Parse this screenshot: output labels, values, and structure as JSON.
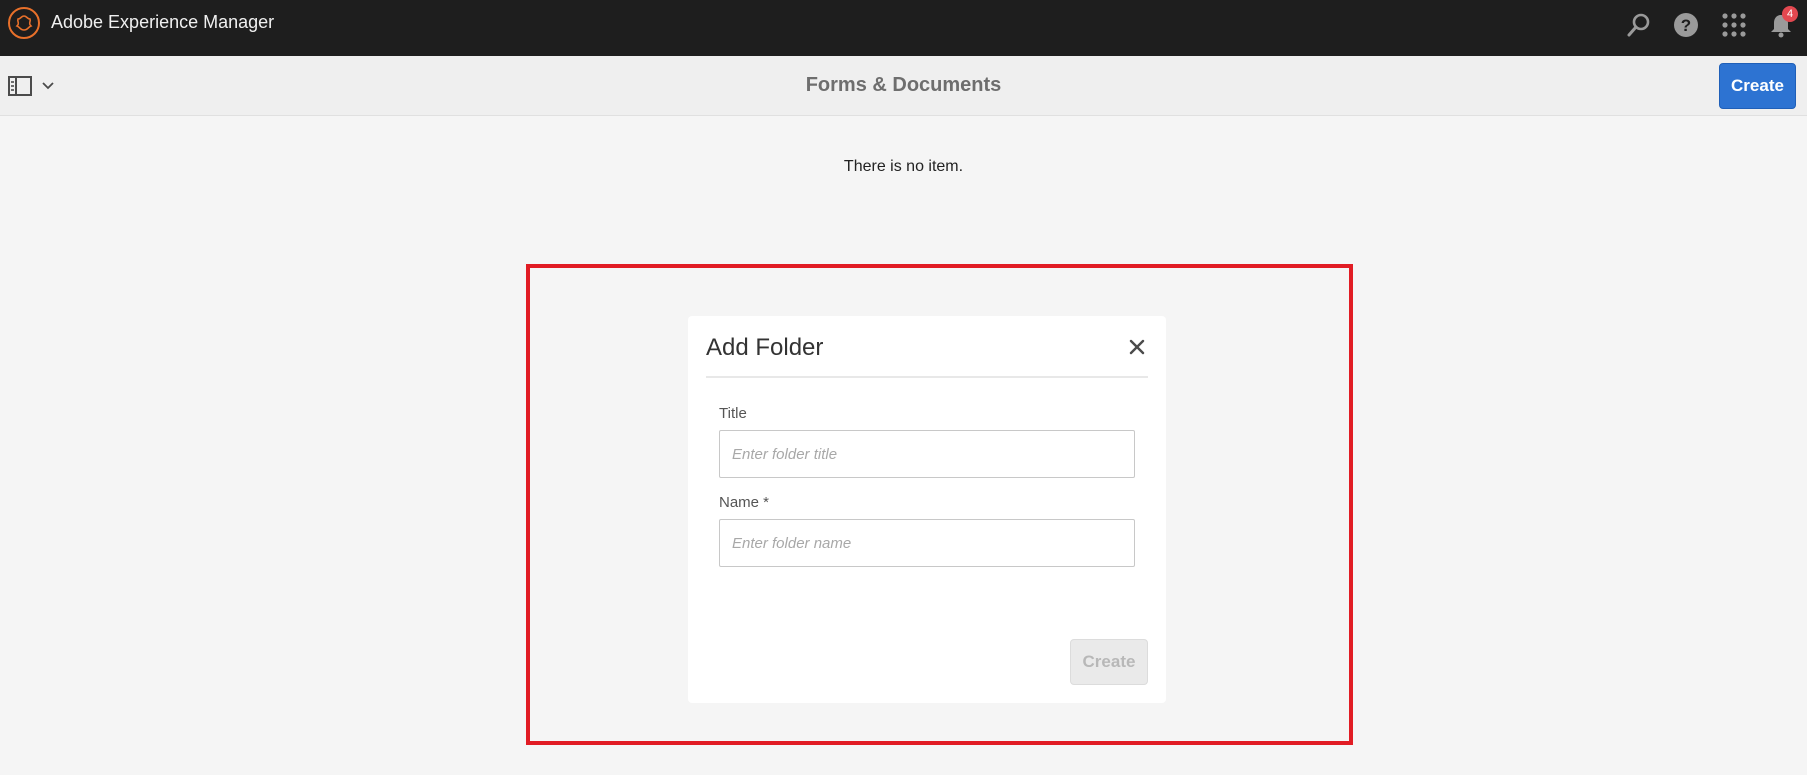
{
  "shell": {
    "brand": "Adobe Experience Manager",
    "notification_count": "4",
    "icons": [
      "search-icon",
      "help-icon",
      "apps-grid-icon",
      "bell-icon"
    ]
  },
  "actionbar": {
    "title": "Forms & Documents",
    "create_label": "Create"
  },
  "content": {
    "empty_message": "There is no item."
  },
  "dialog": {
    "title": "Add Folder",
    "title_label": "Title",
    "title_placeholder": "Enter folder title",
    "name_label": "Name *",
    "name_placeholder": "Enter folder name",
    "create_label": "Create"
  },
  "colors": {
    "shell_bg": "#1e1e1e",
    "brand_accent": "#e8702a",
    "primary_button": "#2d73d2",
    "highlight": "#e11c24"
  }
}
